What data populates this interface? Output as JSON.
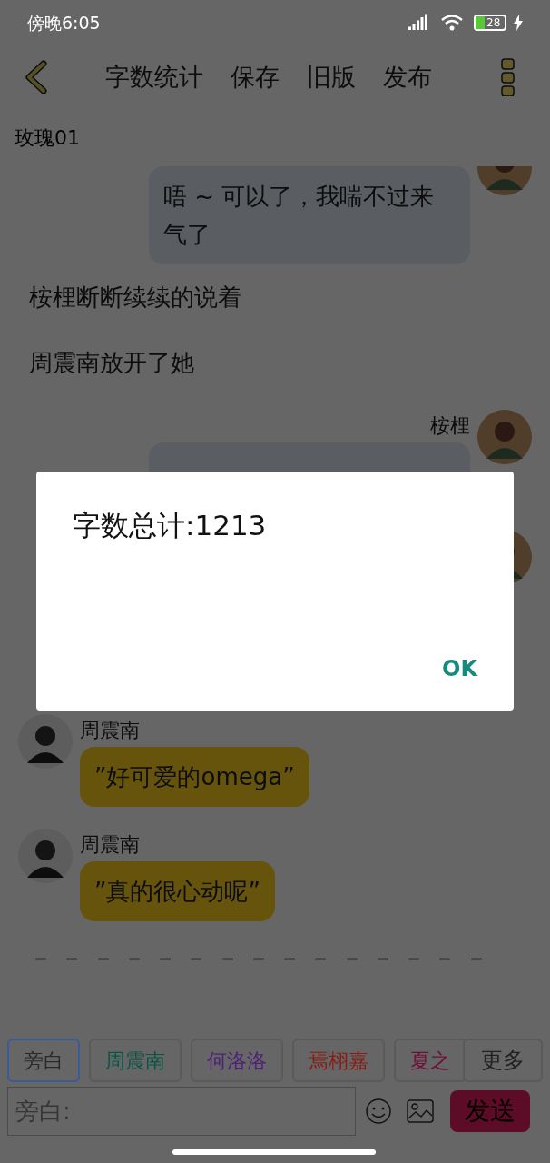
{
  "status_bar": {
    "time": "傍晚6:05",
    "battery": "28"
  },
  "toolbar": {
    "actions": [
      "字数统计",
      "保存",
      "旧版",
      "发布"
    ]
  },
  "title": "玫瑰01",
  "messages": [
    {
      "kind": "outgoing",
      "text": "唔 ~ 可以了，我喘不过来气了"
    },
    {
      "kind": "narration",
      "text": "桉梩断断续续的说着"
    },
    {
      "kind": "narration",
      "text": "周震南放开了她"
    },
    {
      "kind": "outgoing",
      "speaker": "桉梩"
    },
    {
      "kind": "outgoing"
    },
    {
      "kind": "incoming",
      "speaker": "周震南",
      "text": "”好可爱的omega”"
    },
    {
      "kind": "incoming",
      "speaker": "周震南",
      "text": "”真的很心动呢”"
    },
    {
      "kind": "narration",
      "text": "－ － － － － － － － － － － － － － －"
    }
  ],
  "characters": [
    {
      "name": "旁白",
      "color": "#2a2a2a",
      "selected": true
    },
    {
      "name": "周震南",
      "color": "#0a5443",
      "selected": false
    },
    {
      "name": "何洛洛",
      "color": "#4e2178",
      "selected": false
    },
    {
      "name": "焉栩嘉",
      "color": "#8a1a12",
      "selected": false
    },
    {
      "name": "夏之",
      "color": "#6e0f38",
      "selected": false
    }
  ],
  "more_button": "更多",
  "input": {
    "placeholder": "旁白:"
  },
  "send_button": "发送",
  "dialog": {
    "text": "字数总计:1213",
    "button": "OK"
  }
}
